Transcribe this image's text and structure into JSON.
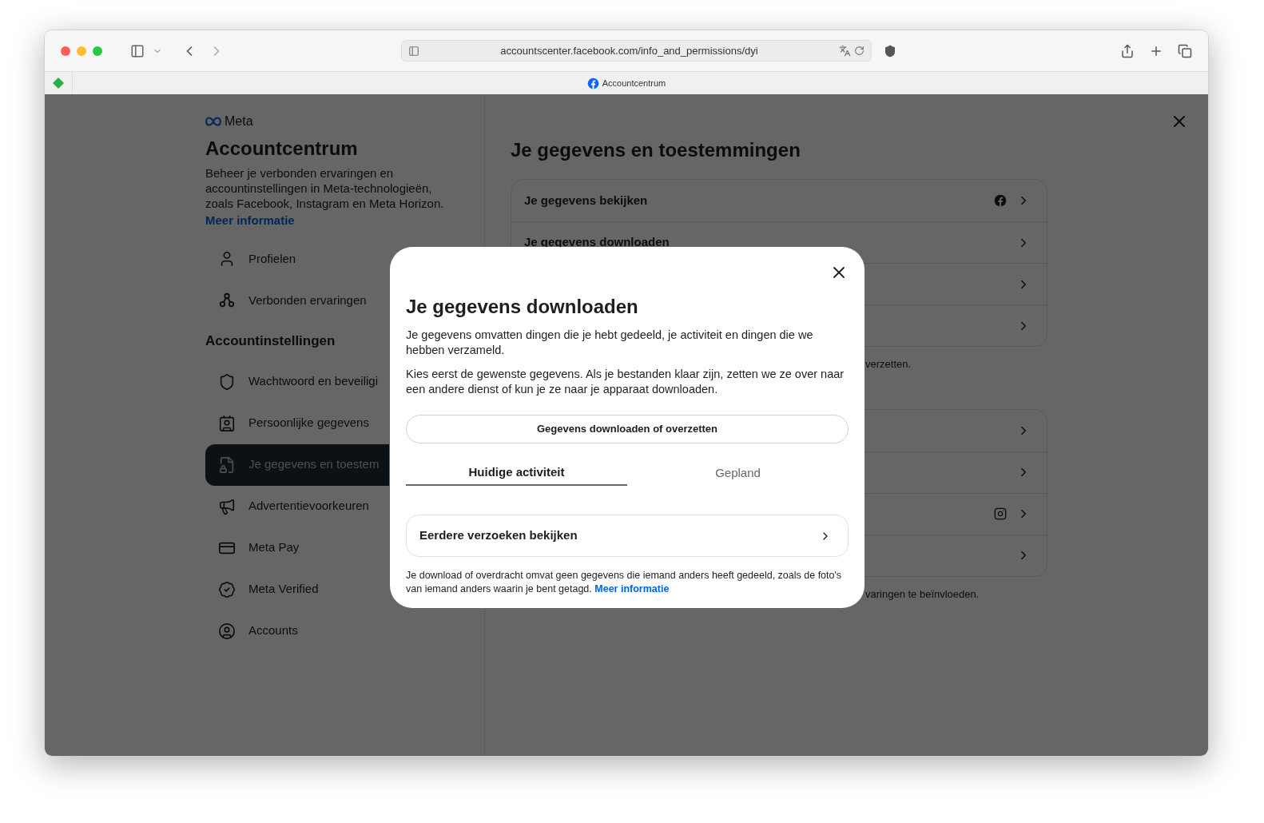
{
  "browser": {
    "url": "accountscenter.facebook.com/info_and_permissions/dyi",
    "tab_title": "Accountcentrum"
  },
  "sidebar": {
    "brand": "Meta",
    "title": "Accountcentrum",
    "description": "Beheer je verbonden ervaringen en accountinstellingen in Meta-technologieën, zoals Facebook, Instagram en Meta Horizon.",
    "link": "Meer informatie",
    "items": [
      {
        "label": "Profielen",
        "selected": false
      },
      {
        "label": "Verbonden ervaringen",
        "selected": false
      }
    ],
    "section": "Accountinstellingen",
    "settings": [
      {
        "label": "Wachtwoord en beveiligi",
        "selected": false
      },
      {
        "label": "Persoonlijke gegevens",
        "selected": false
      },
      {
        "label": "Je gegevens en toestem",
        "selected": true
      },
      {
        "label": "Advertentievoorkeuren",
        "selected": false
      },
      {
        "label": "Meta Pay",
        "selected": false
      },
      {
        "label": "Meta Verified",
        "selected": false
      },
      {
        "label": "Accounts",
        "selected": false
      }
    ]
  },
  "main": {
    "title": "Je gegevens en toestemmingen",
    "groups": [
      {
        "rows": [
          {
            "label": "Je gegevens bekijken",
            "kind": "facebook"
          },
          {
            "label": "Je gegevens downloaden"
          },
          {},
          {}
        ],
        "note": "verzetten."
      },
      {
        "rows": [
          {},
          {},
          {
            "kind": "instagram"
          },
          {}
        ],
        "note": "varingen te beïnvloeden."
      }
    ]
  },
  "modal": {
    "title": "Je gegevens downloaden",
    "paragraphs": [
      "Je gegevens omvatten dingen die je hebt gedeeld, je activiteit en dingen die we hebben verzameld.",
      "Kies eerst de gewenste gegevens. Als je bestanden klaar zijn, zetten we ze over naar een andere dienst of kun je ze naar je apparaat downloaden."
    ],
    "button": "Gegevens downloaden of overzetten",
    "tabs": [
      {
        "label": "Huidige activiteit",
        "selected": true
      },
      {
        "label": "Gepland",
        "selected": false
      }
    ],
    "row": "Eerdere verzoeken bekijken",
    "footnote": "Je download of overdracht omvat geen gegevens die iemand anders heeft gedeeld, zoals de foto's van iemand anders waarin je bent getagd.",
    "footnote_link": "Meer informatie"
  }
}
